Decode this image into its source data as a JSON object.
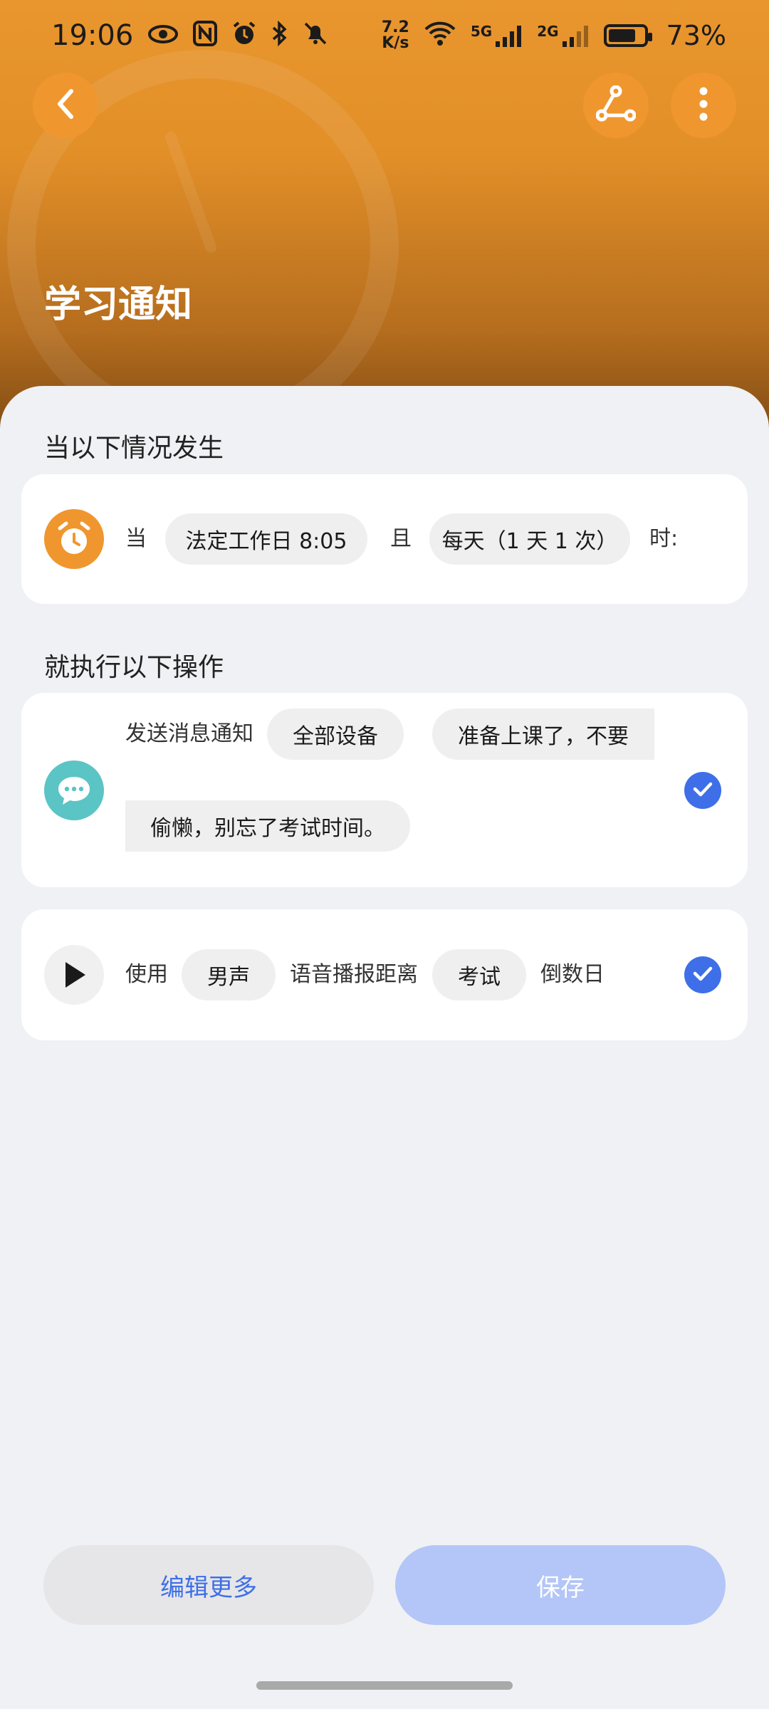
{
  "status_bar": {
    "time": "19:06",
    "net_speed_value": "7.2",
    "net_speed_unit": "K/s",
    "signal_1": "5G",
    "signal_2": "2G",
    "battery": "73%"
  },
  "header": {
    "title": "学习通知",
    "back_icon": "back-arrow-icon",
    "share_icon": "route-share-icon",
    "more_icon": "more-vertical-icon",
    "color": "#e9962f"
  },
  "trigger_section": {
    "label": "当以下情况发生",
    "prefix": "当",
    "time_chip": "法定工作日 8:05",
    "conjunction": "且",
    "repeat_chip": "每天（1 天 1 次）",
    "suffix": "时:",
    "icon": "alarm-clock-icon",
    "icon_color": "#f0962e"
  },
  "action_section": {
    "label": "就执行以下操作",
    "notify": {
      "text": "发送消息通知",
      "device_chip": "全部设备",
      "message_line1": "准备上课了，不要",
      "message_line2": "偷懒，别忘了考试时间。",
      "icon": "chat-bubble-icon",
      "icon_color": "#5bc4c5",
      "checked": true
    },
    "voice": {
      "prefix": "使用",
      "voice_chip": "男声",
      "middle": "语音播报距离",
      "event_chip": "考试",
      "suffix": "倒数日",
      "icon": "play-icon",
      "checked": true
    }
  },
  "buttons": {
    "edit_more": "编辑更多",
    "save": "保存"
  },
  "accent_color": "#3e6fe8"
}
